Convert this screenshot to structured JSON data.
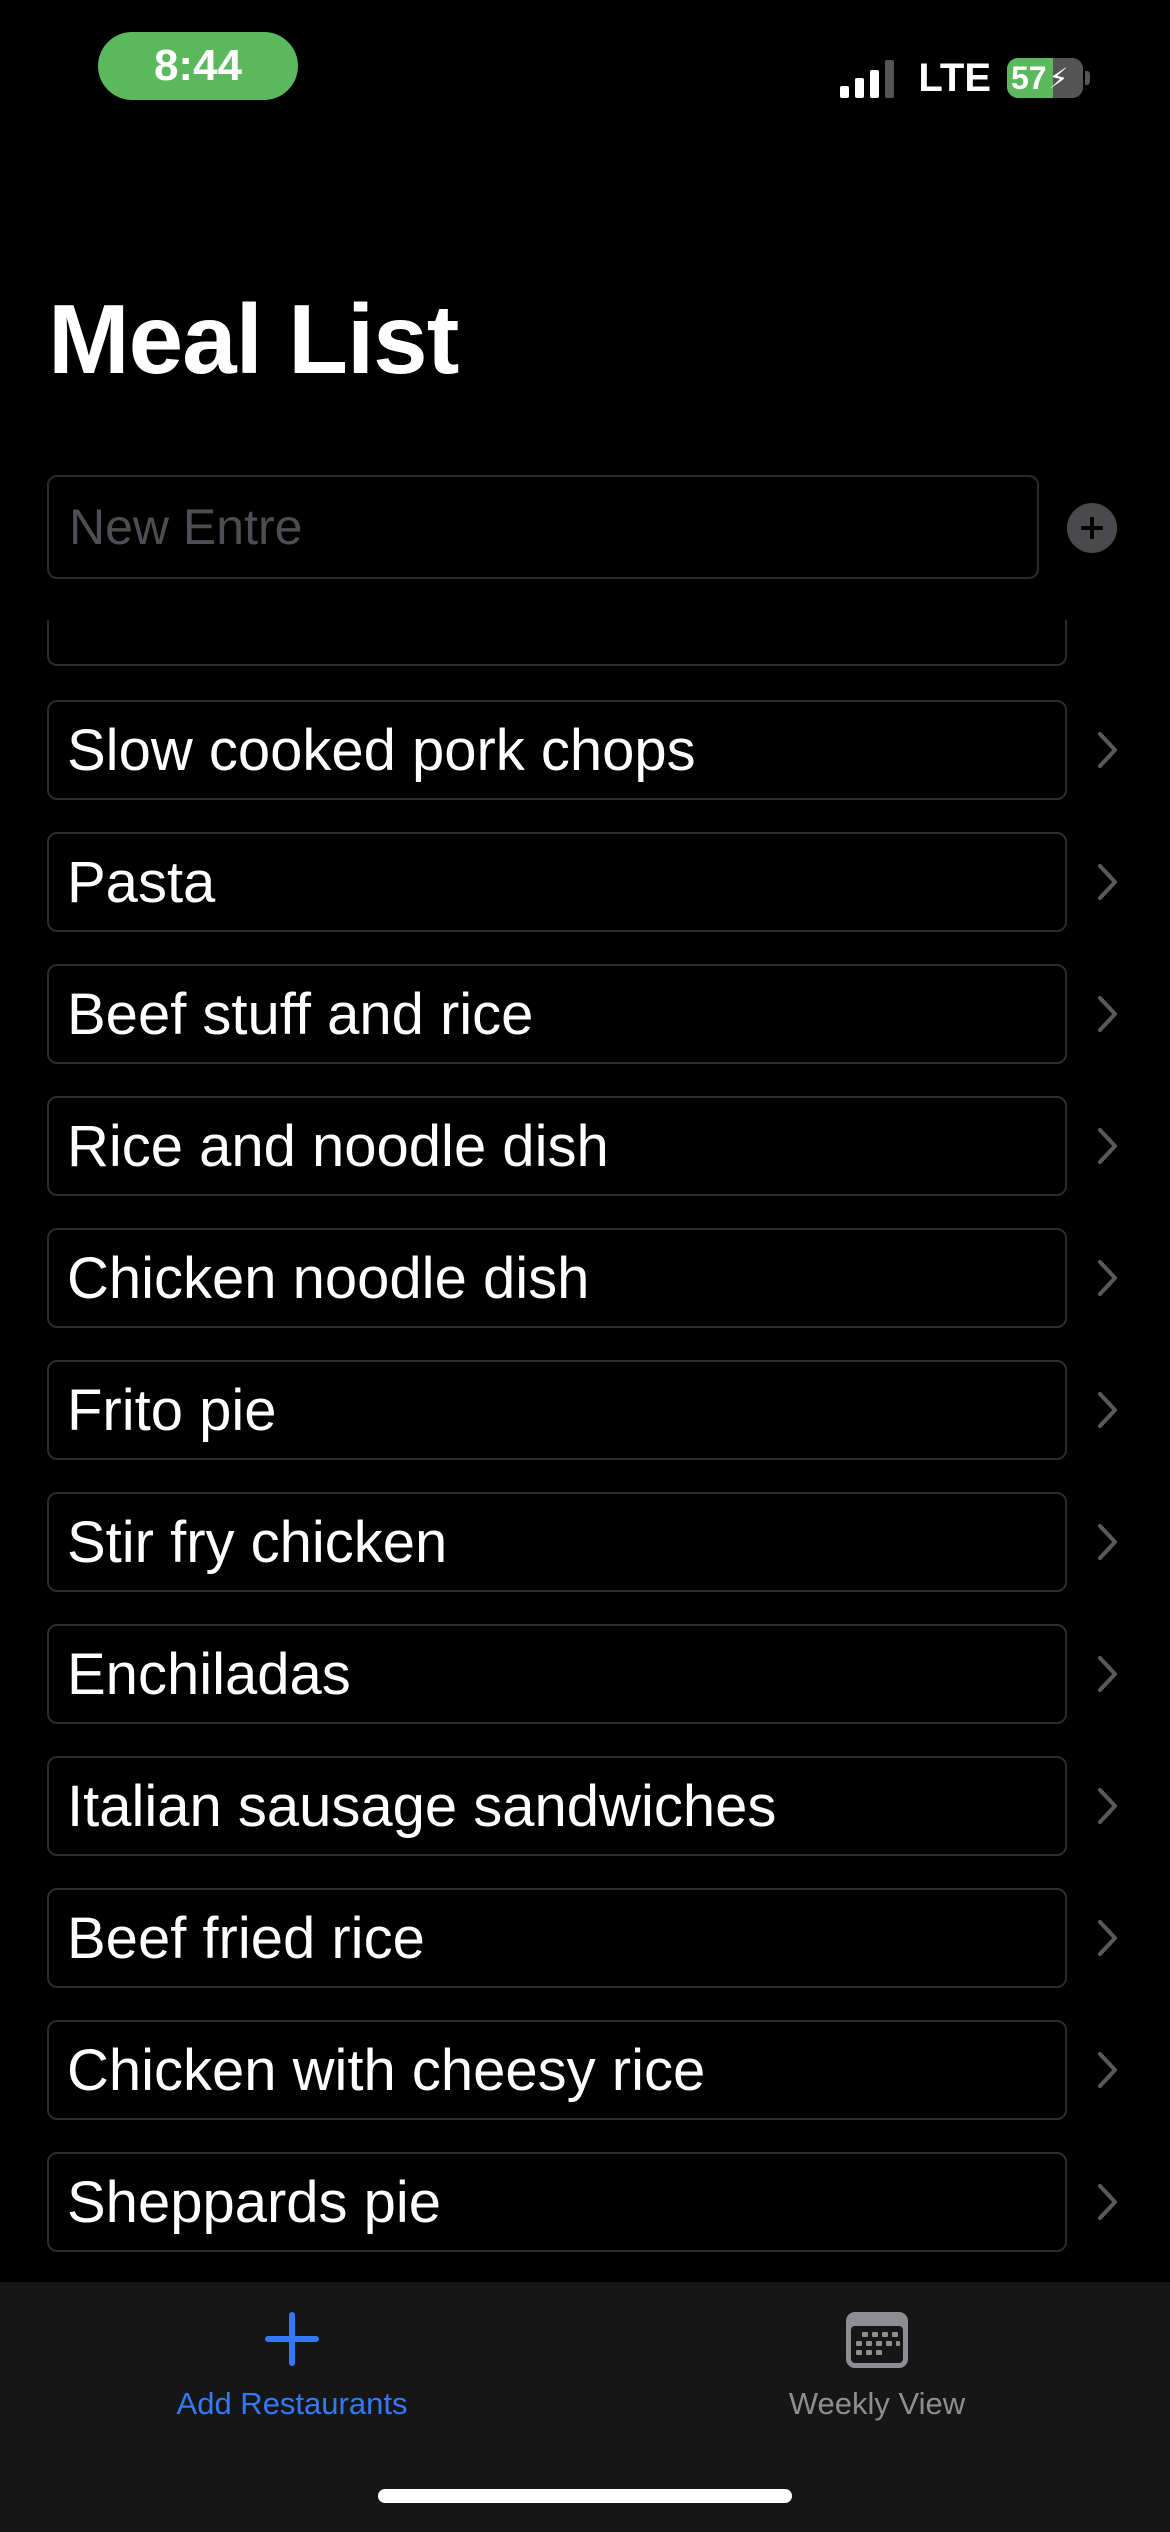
{
  "status_bar": {
    "time": "8:44",
    "network": "LTE",
    "battery": "57"
  },
  "header": {
    "title": "Meal List"
  },
  "new_entry": {
    "placeholder": "New Entre",
    "value": ""
  },
  "meals": [
    {
      "name": "Slow cooked pork chops"
    },
    {
      "name": "Pasta"
    },
    {
      "name": "Beef stuff and rice"
    },
    {
      "name": "Rice and noodle dish"
    },
    {
      "name": "Chicken noodle dish"
    },
    {
      "name": "Frito pie"
    },
    {
      "name": "Stir fry chicken"
    },
    {
      "name": "Enchiladas"
    },
    {
      "name": "Italian sausage sandwiches"
    },
    {
      "name": "Beef fried rice"
    },
    {
      "name": "Chicken with cheesy rice"
    },
    {
      "name": "Sheppards pie"
    }
  ],
  "tab_bar": {
    "tabs": [
      {
        "label": "Add Restaurants",
        "icon": "plus-icon",
        "selected": true
      },
      {
        "label": "Weekly View",
        "icon": "calendar-icon",
        "selected": false
      }
    ]
  },
  "colors": {
    "background": "#000000",
    "accent": "#3478f6",
    "status_green": "#5cb85c",
    "tab_inactive": "#8d8d92"
  }
}
